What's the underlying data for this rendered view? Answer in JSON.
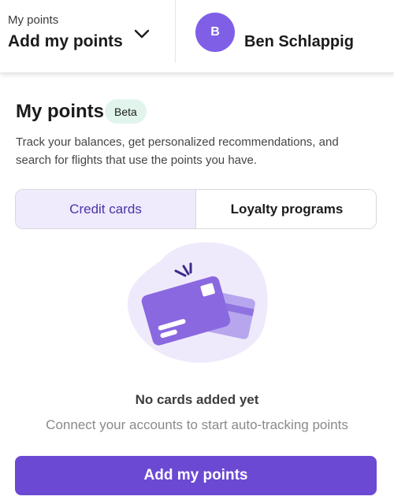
{
  "header": {
    "points_caption": "My points",
    "points_selector_label": "Add my points",
    "selector_icon": "chevron-down-icon",
    "user": {
      "initial": "B",
      "name": "Ben Schlappig",
      "avatar_color": "#7f5fe6"
    }
  },
  "page": {
    "title": "My points",
    "badge": "Beta",
    "badge_color": "#e1f5ed",
    "description": "Track your balances, get personalized recommendations, and search for flights that use the points you have."
  },
  "tabs": [
    {
      "label": "Credit cards",
      "selected": true
    },
    {
      "label": "Loyalty programs",
      "selected": false
    }
  ],
  "empty_state": {
    "illustration_icon": "credit-cards-icon",
    "title": "No cards added yet",
    "subtitle": "Connect your accounts to start auto-tracking points"
  },
  "primary_button": {
    "label": "Add my points",
    "color": "#6c49d3"
  },
  "colors": {
    "accent": "#6c49d3",
    "selected_tab_bg": "#efeafc",
    "selected_tab_text": "#4c33a8"
  }
}
